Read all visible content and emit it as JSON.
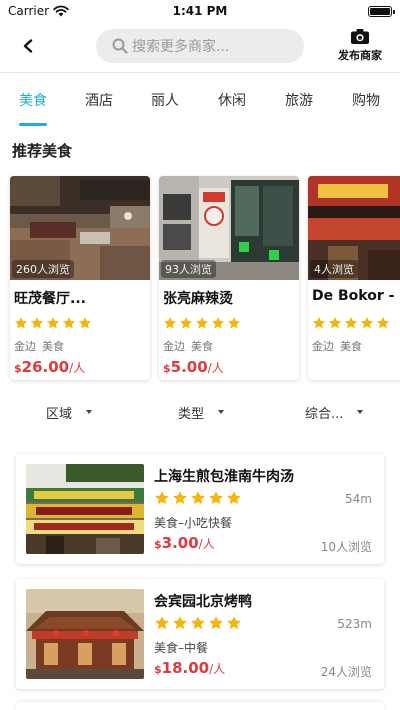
{
  "status_bar": {
    "carrier": "Carrier",
    "time": "1:41 PM"
  },
  "nav": {
    "search_placeholder": "搜索更多商家...",
    "publish_label": "发布商家"
  },
  "tabs": [
    {
      "label": "美食",
      "active": true
    },
    {
      "label": "酒店",
      "active": false
    },
    {
      "label": "丽人",
      "active": false
    },
    {
      "label": "休闲",
      "active": false
    },
    {
      "label": "旅游",
      "active": false
    },
    {
      "label": "购物",
      "active": false
    }
  ],
  "section_title": "推荐美食",
  "recommended": [
    {
      "name": "旺茂餐厅...",
      "views": "260人浏览",
      "stars": 5,
      "area": "金边",
      "category": "美食",
      "currency": "$",
      "price": "26.00",
      "unit": "/人"
    },
    {
      "name": "张亮麻辣烫",
      "views": "93人浏览",
      "stars": 5,
      "area": "金边",
      "category": "美食",
      "currency": "$",
      "price": "5.00",
      "unit": "/人"
    },
    {
      "name": "De Bokor -",
      "views": "4人浏览",
      "stars": 5,
      "area": "金边",
      "category": "美食",
      "currency": "",
      "price": "",
      "unit": ""
    }
  ],
  "filters": [
    {
      "label": "区域"
    },
    {
      "label": "类型"
    },
    {
      "label": "综合..."
    }
  ],
  "listings": [
    {
      "name": "上海生煎包淮南牛肉汤",
      "stars": 5,
      "distance": "54m",
      "category": "美食–小吃快餐",
      "currency": "$",
      "price": "3.00",
      "unit": "/人",
      "views": "10人浏览"
    },
    {
      "name": "会宾园北京烤鸭",
      "stars": 5,
      "distance": "523m",
      "category": "美食–中餐",
      "currency": "$",
      "price": "18.00",
      "unit": "/人",
      "views": "24人浏览"
    }
  ],
  "colors": {
    "accent": "#1aaed8",
    "price": "#e0393e",
    "star": "#f5b50a"
  }
}
